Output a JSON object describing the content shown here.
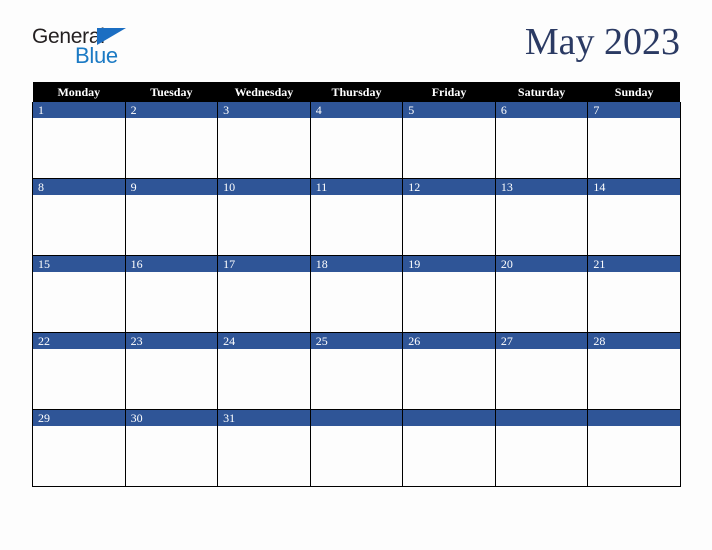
{
  "brand": {
    "name_top": "General",
    "name_bottom": "Blue",
    "top_color": "#231f20",
    "bottom_color": "#1b7ac4",
    "triangle_color": "#1b6ec2"
  },
  "header": {
    "title": "May 2023"
  },
  "theme": {
    "header_bar_color": "#000000",
    "date_band_color": "#2f5597",
    "date_text_color": "#ffffff",
    "cell_background": "#fdfdfd",
    "grid_line_color": "#000000",
    "title_color": "#2b3a63",
    "page_background": "#fdfdfd"
  },
  "calendar": {
    "month": "May",
    "year": "2023",
    "week_start": "Monday",
    "day_headers": [
      "Monday",
      "Tuesday",
      "Wednesday",
      "Thursday",
      "Friday",
      "Saturday",
      "Sunday"
    ],
    "weeks": [
      [
        "1",
        "2",
        "3",
        "4",
        "5",
        "6",
        "7"
      ],
      [
        "8",
        "9",
        "10",
        "11",
        "12",
        "13",
        "14"
      ],
      [
        "15",
        "16",
        "17",
        "18",
        "19",
        "20",
        "21"
      ],
      [
        "22",
        "23",
        "24",
        "25",
        "26",
        "27",
        "28"
      ],
      [
        "29",
        "30",
        "31",
        "",
        "",
        "",
        ""
      ]
    ]
  }
}
